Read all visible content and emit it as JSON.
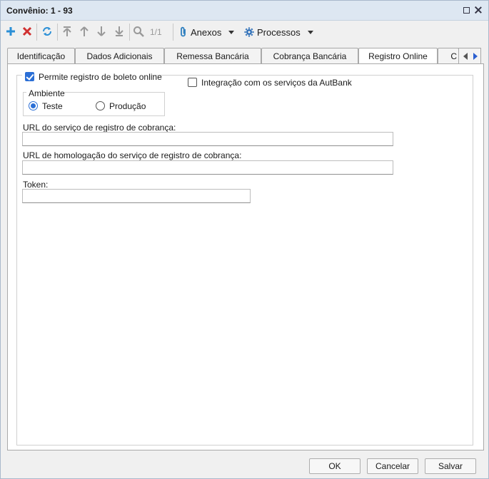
{
  "window": {
    "title": "Convênio: 1 - 93"
  },
  "toolbar": {
    "add_icon": "plus-icon",
    "delete_icon": "x-icon",
    "refresh_icon": "refresh-icon",
    "first_icon": "arrow-to-top-icon",
    "prev_icon": "arrow-up-icon",
    "next_icon": "arrow-down-icon",
    "last_icon": "arrow-to-bottom-icon",
    "search_icon": "magnifier-icon",
    "page_indicator": "1/1",
    "attachments_label": "Anexos",
    "processes_label": "Processos",
    "accent_add": "#2b8fd6",
    "accent_delete": "#d03030"
  },
  "tabs": [
    {
      "label": "Identificação"
    },
    {
      "label": "Dados Adicionais"
    },
    {
      "label": "Remessa Bancária"
    },
    {
      "label": "Cobrança Bancária"
    },
    {
      "label": "Registro Online"
    },
    {
      "label": "C"
    }
  ],
  "active_tab": "Registro Online",
  "form": {
    "online_register": {
      "label": "Permite registro de boleto online",
      "checked": true
    },
    "autbank": {
      "label": "Integração com os serviços da AutBank",
      "checked": false
    },
    "environment": {
      "legend": "Ambiente",
      "options": [
        {
          "label": "Teste",
          "selected": true
        },
        {
          "label": "Produção",
          "selected": false
        }
      ]
    },
    "url_register": {
      "label": "URL do serviço de registro de cobrança:",
      "value": ""
    },
    "url_homolog": {
      "label": "URL de homologação do serviço de registro de cobrança:",
      "value": ""
    },
    "token": {
      "label": "Token:",
      "value": ""
    }
  },
  "buttons": {
    "ok": "OK",
    "cancel": "Cancelar",
    "save": "Salvar"
  }
}
